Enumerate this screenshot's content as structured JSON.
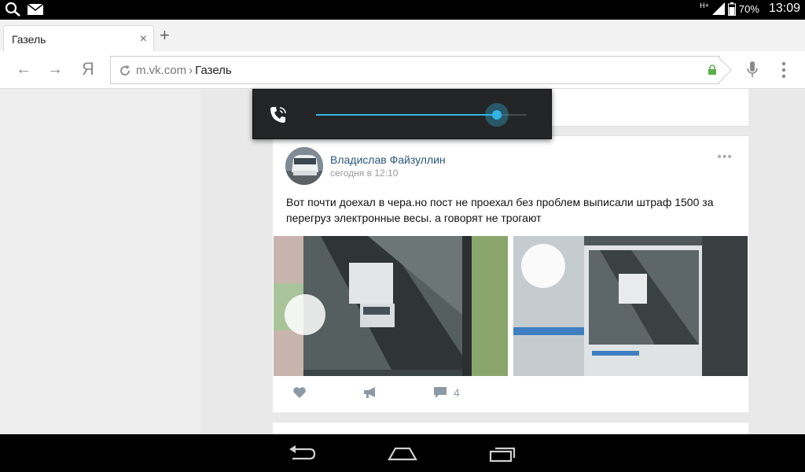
{
  "status_bar": {
    "network": "H+",
    "battery": "70%",
    "time": "13:09"
  },
  "browser": {
    "tab": {
      "title": "Газель",
      "close": "×"
    },
    "new_tab": "+",
    "nav": {
      "back": "←",
      "forward": "→",
      "yandex": "Я"
    },
    "url": {
      "domain": "m.vk.com",
      "separator": "›",
      "page": "Газель"
    }
  },
  "volume": {
    "level_percent": 86
  },
  "post": {
    "author": "Владислав Файзуллин",
    "time": "сегодня в 12:10",
    "text": "Вот почти доехал в чера.но пост не проехал без проблем выписали штраф 1500 за перегруз электронные весы. а говорят не трогают",
    "comments": "4"
  },
  "colors": {
    "accent": "#33b5e5",
    "link": "#2b587a",
    "secure": "#5cad4a"
  },
  "icons": [
    "search-icon",
    "mail-icon",
    "signal-icon",
    "battery-icon",
    "back-icon",
    "forward-icon",
    "yandex-icon",
    "reload-icon",
    "lock-icon",
    "mic-icon",
    "menu-icon",
    "phone-icon",
    "like-icon",
    "share-icon",
    "comment-icon",
    "nav-back-icon",
    "nav-home-icon",
    "nav-recents-icon"
  ]
}
